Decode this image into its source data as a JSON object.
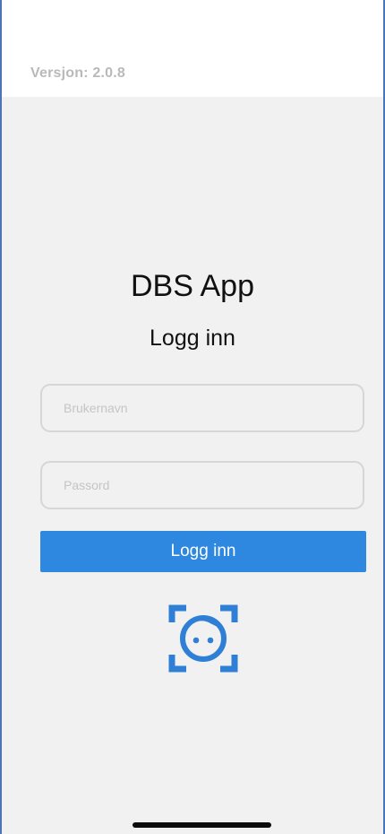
{
  "header": {
    "version_text": "Versjon: 2.0.8"
  },
  "main": {
    "app_title": "DBS App",
    "login_heading": "Logg inn",
    "username_placeholder": "Brukernavn",
    "password_placeholder": "Passord",
    "login_button_label": "Logg inn",
    "biometric_icon": "face-id-icon"
  },
  "colors": {
    "accent": "#2f88e0",
    "background": "#f1f1f1",
    "header_background": "#ffffff",
    "version_text": "#b9b9b9"
  }
}
